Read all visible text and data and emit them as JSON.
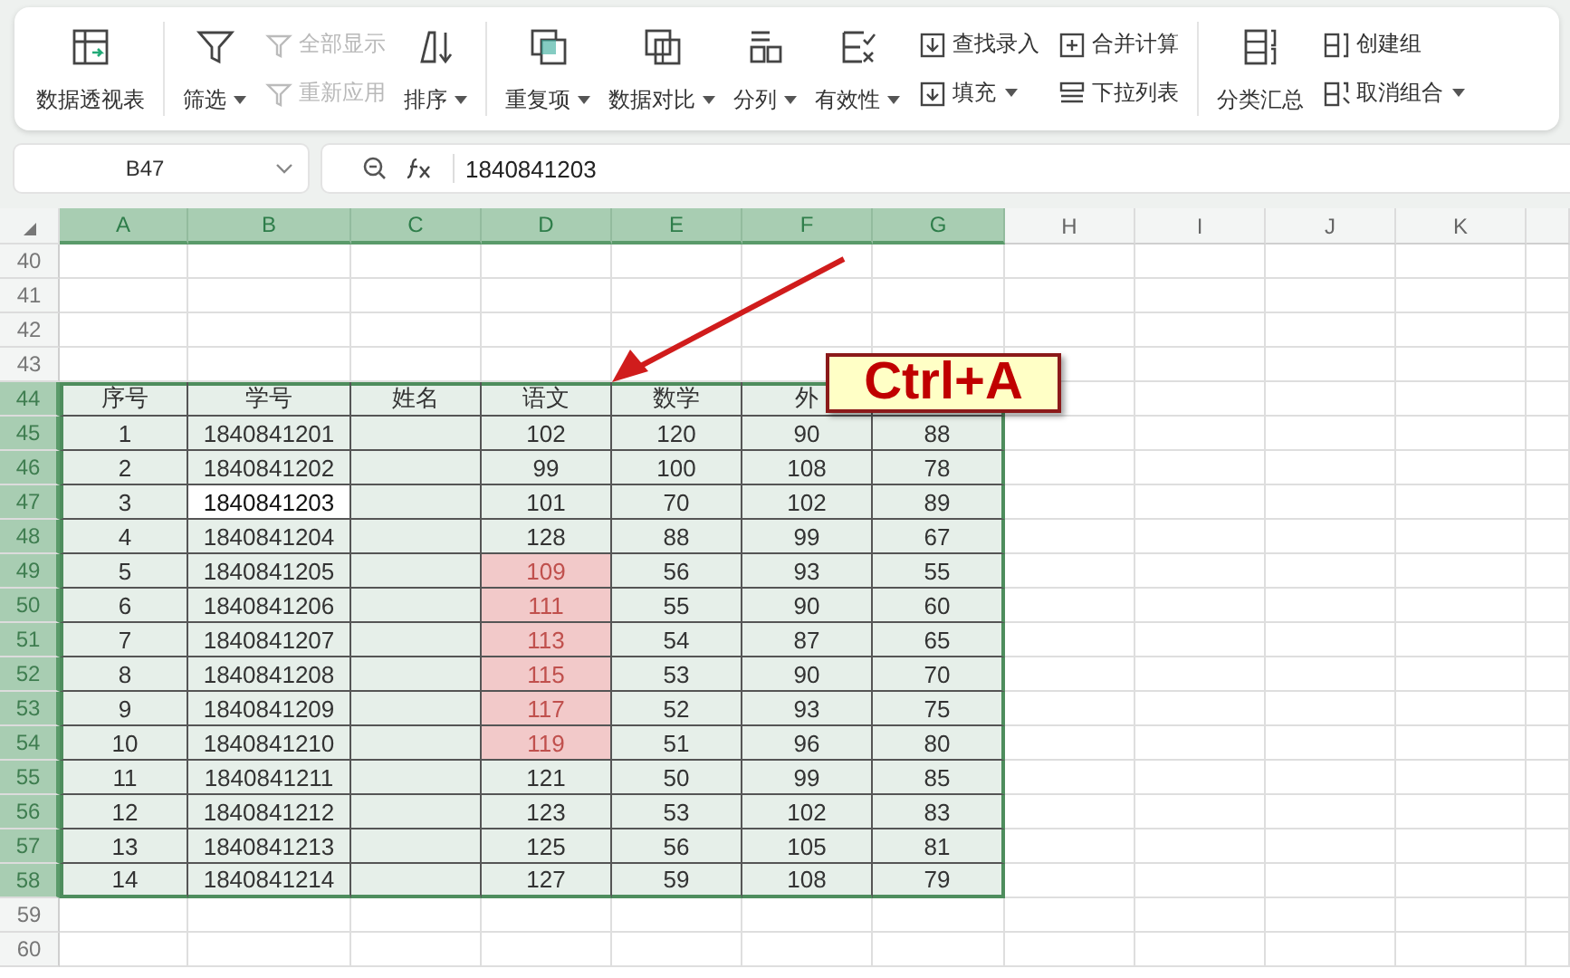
{
  "ribbon": [
    {
      "items": [
        {
          "kind": "large",
          "label": "数据透视表",
          "dropdown": false,
          "disabled": false
        }
      ]
    },
    {
      "items": [
        {
          "kind": "large",
          "label": "筛选",
          "dropdown": true,
          "disabled": false
        },
        {
          "kind": "stack",
          "items": [
            {
              "label": "全部显示",
              "dropdown": false,
              "disabled": true
            },
            {
              "label": "重新应用",
              "dropdown": false,
              "disabled": true
            }
          ]
        },
        {
          "kind": "large",
          "label": "排序",
          "dropdown": true,
          "disabled": false
        }
      ]
    },
    {
      "items": [
        {
          "kind": "large",
          "label": "重复项",
          "dropdown": true,
          "disabled": false
        },
        {
          "kind": "large",
          "label": "数据对比",
          "dropdown": true,
          "disabled": false
        },
        {
          "kind": "large",
          "label": "分列",
          "dropdown": true,
          "disabled": false
        },
        {
          "kind": "large",
          "label": "有效性",
          "dropdown": true,
          "disabled": false
        },
        {
          "kind": "stack",
          "items": [
            {
              "label": "查找录入",
              "dropdown": false,
              "disabled": false
            },
            {
              "label": "填充",
              "dropdown": true,
              "disabled": false
            }
          ]
        },
        {
          "kind": "stack",
          "items": [
            {
              "label": "合并计算",
              "dropdown": false,
              "disabled": false
            },
            {
              "label": "下拉列表",
              "dropdown": false,
              "disabled": false
            }
          ]
        }
      ]
    },
    {
      "items": [
        {
          "kind": "large",
          "label": "分类汇总",
          "dropdown": false,
          "disabled": false
        },
        {
          "kind": "stack",
          "items": [
            {
              "label": "创建组",
              "dropdown": false,
              "disabled": false
            },
            {
              "label": "取消组合",
              "dropdown": true,
              "disabled": false
            }
          ]
        }
      ]
    }
  ],
  "formula_bar": {
    "name_box": "B47",
    "formula": "1840841203"
  },
  "sheet": {
    "columns": [
      {
        "label": "A",
        "selected": true
      },
      {
        "label": "B",
        "selected": true
      },
      {
        "label": "C",
        "selected": true
      },
      {
        "label": "D",
        "selected": true
      },
      {
        "label": "E",
        "selected": true
      },
      {
        "label": "F",
        "selected": true
      },
      {
        "label": "G",
        "selected": true
      },
      {
        "label": "H",
        "selected": false
      },
      {
        "label": "I",
        "selected": false
      },
      {
        "label": "J",
        "selected": false
      },
      {
        "label": "K",
        "selected": false
      }
    ],
    "row_numbers": [
      {
        "label": "40",
        "selected": false
      },
      {
        "label": "41",
        "selected": false
      },
      {
        "label": "42",
        "selected": false
      },
      {
        "label": "43",
        "selected": false
      },
      {
        "label": "44",
        "selected": true
      },
      {
        "label": "45",
        "selected": true
      },
      {
        "label": "46",
        "selected": true
      },
      {
        "label": "47",
        "selected": true
      },
      {
        "label": "48",
        "selected": true
      },
      {
        "label": "49",
        "selected": true
      },
      {
        "label": "50",
        "selected": true
      },
      {
        "label": "51",
        "selected": true
      },
      {
        "label": "52",
        "selected": true
      },
      {
        "label": "53",
        "selected": true
      },
      {
        "label": "54",
        "selected": true
      },
      {
        "label": "55",
        "selected": true
      },
      {
        "label": "56",
        "selected": true
      },
      {
        "label": "57",
        "selected": true
      },
      {
        "label": "58",
        "selected": true
      },
      {
        "label": "59",
        "selected": false
      },
      {
        "label": "60",
        "selected": false
      }
    ],
    "table": {
      "headers": [
        "序号",
        "学号",
        "姓名",
        "语文",
        "数学",
        "外"
      ],
      "rows": [
        {
          "seq": "1",
          "id": "1840841201",
          "chinese": "102",
          "math": "120",
          "foreign": "90",
          "column_7": "88",
          "id_active": false,
          "chinese_flagged": false
        },
        {
          "seq": "2",
          "id": "1840841202",
          "chinese": "99",
          "math": "100",
          "foreign": "108",
          "column_7": "78",
          "id_active": false,
          "chinese_flagged": false
        },
        {
          "seq": "3",
          "id": "1840841203",
          "chinese": "101",
          "math": "70",
          "foreign": "102",
          "column_7": "89",
          "id_active": true,
          "chinese_flagged": false
        },
        {
          "seq": "4",
          "id": "1840841204",
          "chinese": "128",
          "math": "88",
          "foreign": "99",
          "column_7": "67",
          "id_active": false,
          "chinese_flagged": false
        },
        {
          "seq": "5",
          "id": "1840841205",
          "chinese": "109",
          "math": "56",
          "foreign": "93",
          "column_7": "55",
          "id_active": false,
          "chinese_flagged": true
        },
        {
          "seq": "6",
          "id": "1840841206",
          "chinese": "111",
          "math": "55",
          "foreign": "90",
          "column_7": "60",
          "id_active": false,
          "chinese_flagged": true
        },
        {
          "seq": "7",
          "id": "1840841207",
          "chinese": "113",
          "math": "54",
          "foreign": "87",
          "column_7": "65",
          "id_active": false,
          "chinese_flagged": true
        },
        {
          "seq": "8",
          "id": "1840841208",
          "chinese": "115",
          "math": "53",
          "foreign": "90",
          "column_7": "70",
          "id_active": false,
          "chinese_flagged": true
        },
        {
          "seq": "9",
          "id": "1840841209",
          "chinese": "117",
          "math": "52",
          "foreign": "93",
          "column_7": "75",
          "id_active": false,
          "chinese_flagged": true
        },
        {
          "seq": "10",
          "id": "1840841210",
          "chinese": "119",
          "math": "51",
          "foreign": "96",
          "column_7": "80",
          "id_active": false,
          "chinese_flagged": true
        },
        {
          "seq": "11",
          "id": "1840841211",
          "chinese": "121",
          "math": "50",
          "foreign": "99",
          "column_7": "85",
          "id_active": false,
          "chinese_flagged": false
        },
        {
          "seq": "12",
          "id": "1840841212",
          "chinese": "123",
          "math": "53",
          "foreign": "102",
          "column_7": "83",
          "id_active": false,
          "chinese_flagged": false
        },
        {
          "seq": "13",
          "id": "1840841213",
          "chinese": "125",
          "math": "56",
          "foreign": "105",
          "column_7": "81",
          "id_active": false,
          "chinese_flagged": false
        },
        {
          "seq": "14",
          "id": "1840841214",
          "chinese": "127",
          "math": "59",
          "foreign": "108",
          "column_7": "79",
          "id_active": false,
          "chinese_flagged": false
        }
      ]
    }
  },
  "callout": {
    "text": "Ctrl+A"
  }
}
